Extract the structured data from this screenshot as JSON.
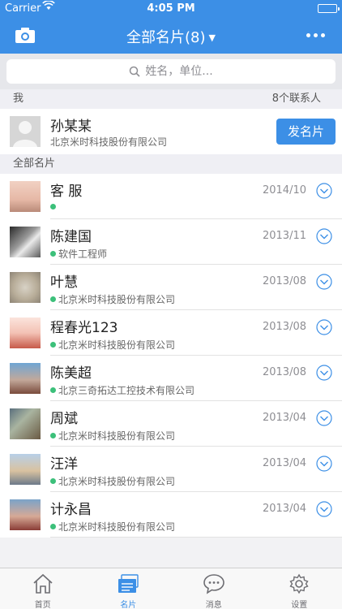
{
  "status": {
    "carrier": "Carrier",
    "time": "4:05 PM"
  },
  "nav": {
    "title": "全部名片(8)"
  },
  "search": {
    "placeholder": "姓名，单位..."
  },
  "me_section": {
    "label": "我",
    "contact_count": "8个联系人"
  },
  "me": {
    "name": "孙某某",
    "company": "北京米时科技股份有限公司",
    "send_label": "发名片"
  },
  "all_section": {
    "label": "全部名片"
  },
  "contacts": [
    {
      "name": "客 服",
      "subtitle": "",
      "date": "2014/10"
    },
    {
      "name": "陈建国",
      "subtitle": "软件工程师",
      "date": "2013/11"
    },
    {
      "name": "叶慧",
      "subtitle": "北京米时科技股份有限公司",
      "date": "2013/08"
    },
    {
      "name": "程春光123",
      "subtitle": "北京米时科技股份有限公司",
      "date": "2013/08"
    },
    {
      "name": "陈美超",
      "subtitle": "北京三奇拓达工控技术有限公司",
      "date": "2013/08"
    },
    {
      "name": "周斌",
      "subtitle": "北京米时科技股份有限公司",
      "date": "2013/04"
    },
    {
      "name": "汪洋",
      "subtitle": "北京米时科技股份有限公司",
      "date": "2013/04"
    },
    {
      "name": "计永昌",
      "subtitle": "北京米时科技股份有限公司",
      "date": "2013/04"
    }
  ],
  "tabs": [
    {
      "label": "首页",
      "icon": "home-icon"
    },
    {
      "label": "名片",
      "icon": "cards-icon"
    },
    {
      "label": "消息",
      "icon": "message-icon"
    },
    {
      "label": "设置",
      "icon": "gear-icon"
    }
  ],
  "colors": {
    "brand": "#3c8fe6",
    "online": "#3cc07a"
  }
}
